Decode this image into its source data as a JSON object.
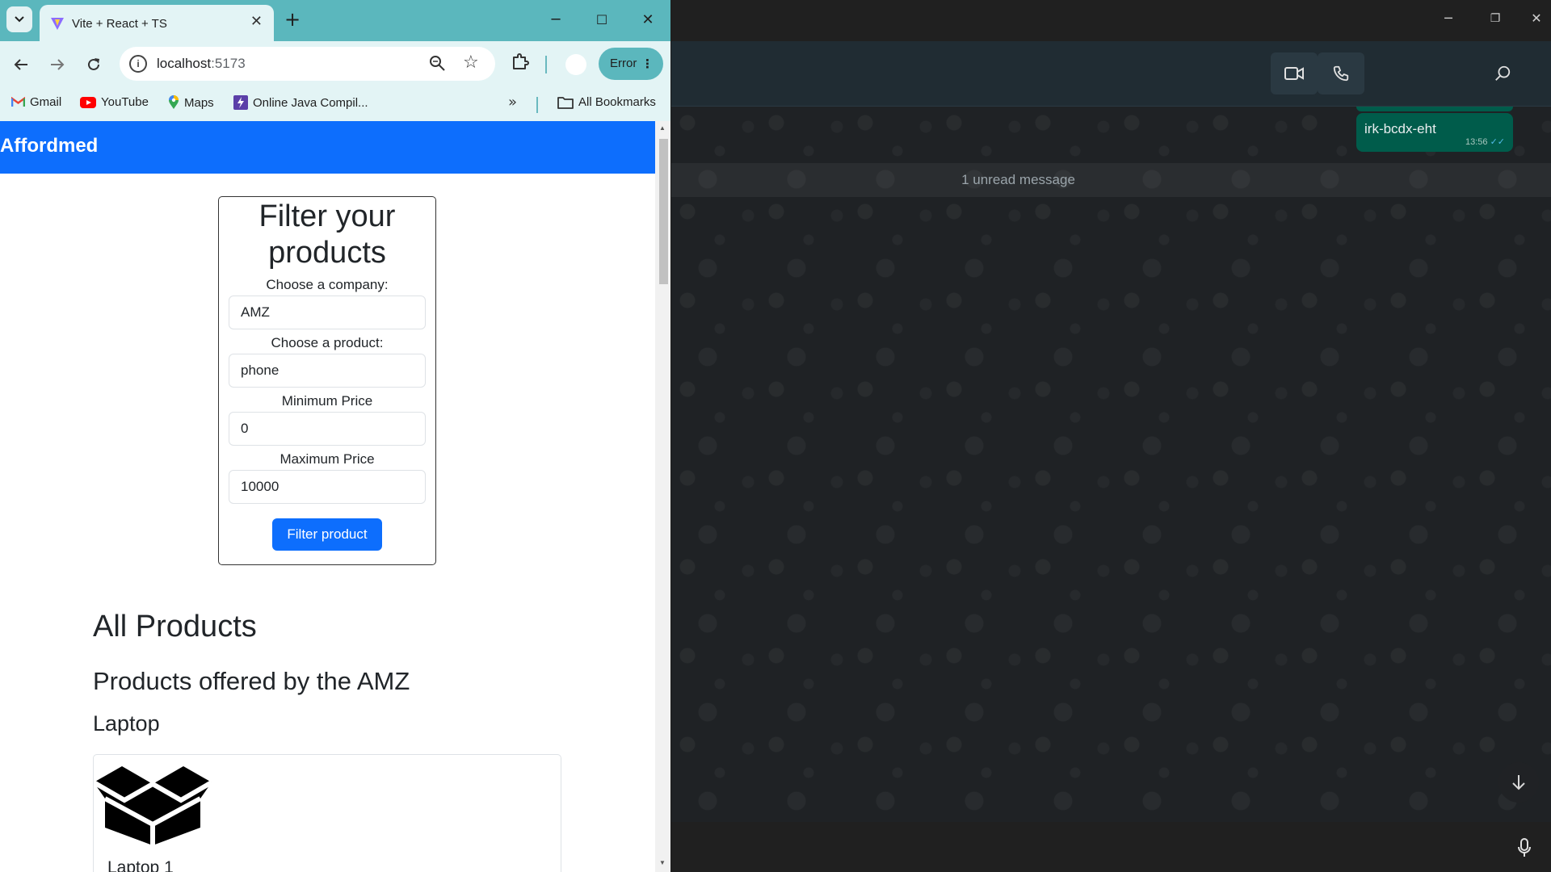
{
  "browser": {
    "tab_title": "Vite + React + TS",
    "url_host": "localhost",
    "url_port": ":5173",
    "error_label": "Error",
    "bookmarks": [
      "Gmail",
      "YouTube",
      "Maps",
      "Online Java Compil...",
      "All Bookmarks"
    ]
  },
  "page": {
    "brand": "Affordmed",
    "filter": {
      "title": "Filter your products",
      "company_label": "Choose a company:",
      "company_value": "AMZ",
      "product_label": "Choose a product:",
      "product_value": "phone",
      "min_label": "Minimum Price",
      "min_value": "0",
      "max_label": "Maximum Price",
      "max_value": "10000",
      "button_label": "Filter product"
    },
    "all_products_heading": "All Products",
    "offered_by_heading": "Products offered by the AMZ",
    "category_heading": "Laptop",
    "product_name": "Laptop 1"
  },
  "whatsapp": {
    "message_text": "irk-bcdx-eht",
    "message_time": "13:56",
    "unread_label": "1 unread message"
  },
  "colors": {
    "chrome_tabstrip": "#5bb7bd",
    "navbar": "#0d6efd",
    "wa_bubble": "#005c4b"
  }
}
